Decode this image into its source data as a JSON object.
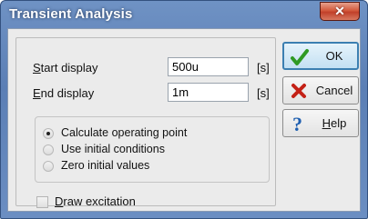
{
  "window": {
    "title": "Transient Analysis",
    "close_glyph": "✕"
  },
  "fields": {
    "start": {
      "label_mnemonic": "S",
      "label_rest": "tart display",
      "value": "500u",
      "unit": "[s]"
    },
    "end": {
      "label_mnemonic": "E",
      "label_rest": "nd display",
      "value": "1m",
      "unit": "[s]"
    }
  },
  "initial_conditions": {
    "options": [
      {
        "label": "Calculate operating point",
        "selected": true
      },
      {
        "label": "Use initial conditions",
        "selected": false
      },
      {
        "label": "Zero initial values",
        "selected": false
      }
    ]
  },
  "draw_excitation": {
    "label_mnemonic": "D",
    "label_rest": "raw excitation",
    "checked": false
  },
  "buttons": {
    "ok": {
      "label": "OK",
      "icon": "check-icon",
      "color": "#2f9a24"
    },
    "cancel": {
      "label": "Cancel",
      "icon": "x-icon",
      "color": "#c42116"
    },
    "help": {
      "label_mnemonic": "H",
      "label_rest": "elp",
      "icon": "question-icon",
      "color": "#1f5fb0"
    }
  }
}
